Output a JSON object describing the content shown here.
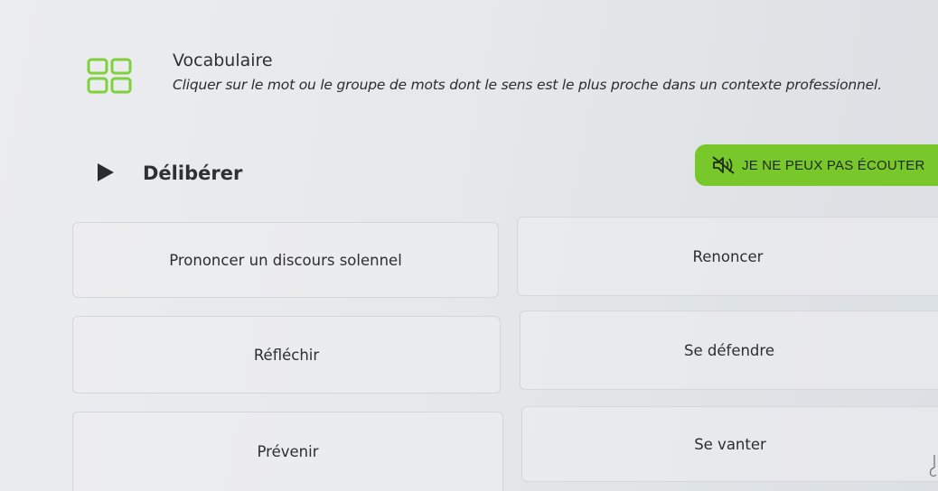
{
  "header": {
    "title": "Vocabulaire",
    "instructions": "Cliquer sur le mot ou le groupe de mots dont le sens est le plus proche dans un contexte professionnel.",
    "icon": "grid-icon"
  },
  "question": {
    "word": "Délibérer",
    "play_icon": "play-icon",
    "cant_listen_label": "JE NE PEUX PAS ÉCOUTER",
    "cant_listen_icon": "speaker-muted-icon",
    "accent_color": "#79c82b"
  },
  "options": [
    {
      "label": "Prononcer un discours solennel"
    },
    {
      "label": "Renoncer"
    },
    {
      "label": "Réfléchir"
    },
    {
      "label": "Se défendre"
    },
    {
      "label": "Prévenir"
    },
    {
      "label": "Se vanter"
    }
  ]
}
